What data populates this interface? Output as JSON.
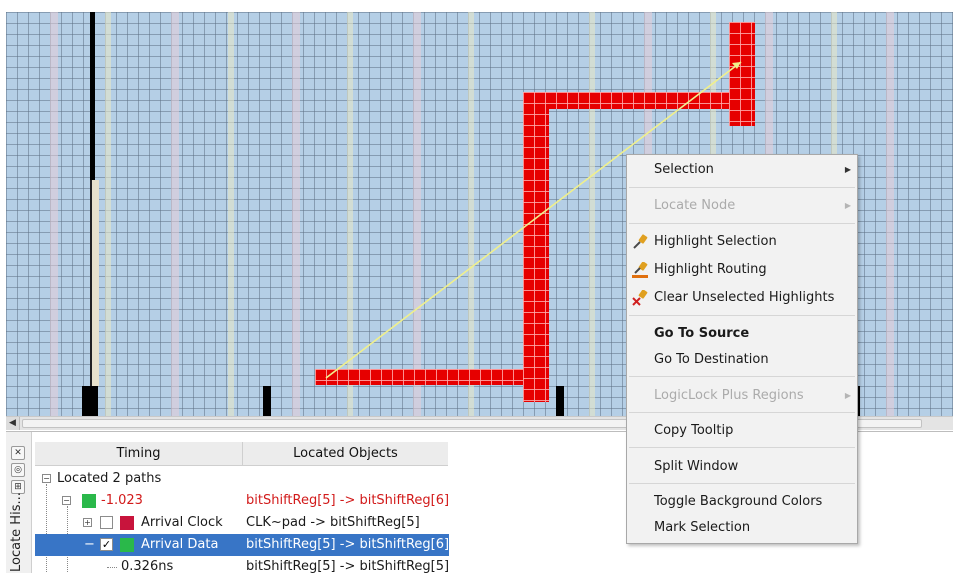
{
  "bottom_panel": {
    "side_title": "Locate His...",
    "columns": {
      "timing": "Timing",
      "located_objects": "Located Objects"
    },
    "rows": [
      {
        "timing": "Located 2 paths",
        "objects": ""
      },
      {
        "timing": "-1.023",
        "objects": "bitShiftReg[5] -> bitShiftReg[6]",
        "swatch_color": "#2ab84a",
        "text_color": "#d21a1a"
      },
      {
        "timing": "Arrival Clock",
        "objects": "CLK~pad -> bitShiftReg[5]",
        "swatch_color": "#c8143c",
        "checked": false
      },
      {
        "timing": "Arrival Data",
        "objects": "bitShiftReg[5] -> bitShiftReg[6]",
        "swatch_color": "#2ab84a",
        "checked": true,
        "selected": true
      },
      {
        "timing": "0.326ns",
        "objects": "bitShiftReg[5] -> bitShiftReg[5]"
      }
    ]
  },
  "context_menu": {
    "items": [
      {
        "label": "Selection",
        "submenu": true,
        "enabled": true
      },
      {
        "label": "Locate Node",
        "submenu": true,
        "enabled": false
      },
      {
        "label": "Highlight Selection",
        "icon": "highlight-selection-icon",
        "enabled": true
      },
      {
        "label": "Highlight Routing",
        "icon": "highlight-routing-icon",
        "enabled": true
      },
      {
        "label": "Clear Unselected Highlights",
        "icon": "clear-highlights-icon",
        "enabled": true
      },
      {
        "label": "Go To Source",
        "enabled": true,
        "bold": true
      },
      {
        "label": "Go To Destination",
        "enabled": true
      },
      {
        "label": "LogicLock Plus Regions",
        "submenu": true,
        "enabled": false
      },
      {
        "label": "Copy Tooltip",
        "enabled": true
      },
      {
        "label": "Split Window",
        "enabled": true
      },
      {
        "label": "Toggle Background Colors",
        "enabled": true
      },
      {
        "label": "Mark Selection",
        "enabled": true
      }
    ]
  },
  "colors": {
    "grid_background": "#b5cfe6",
    "routing_highlight": "#e60000",
    "path_line": "#f0f08c",
    "selection_row": "#3875c6"
  }
}
